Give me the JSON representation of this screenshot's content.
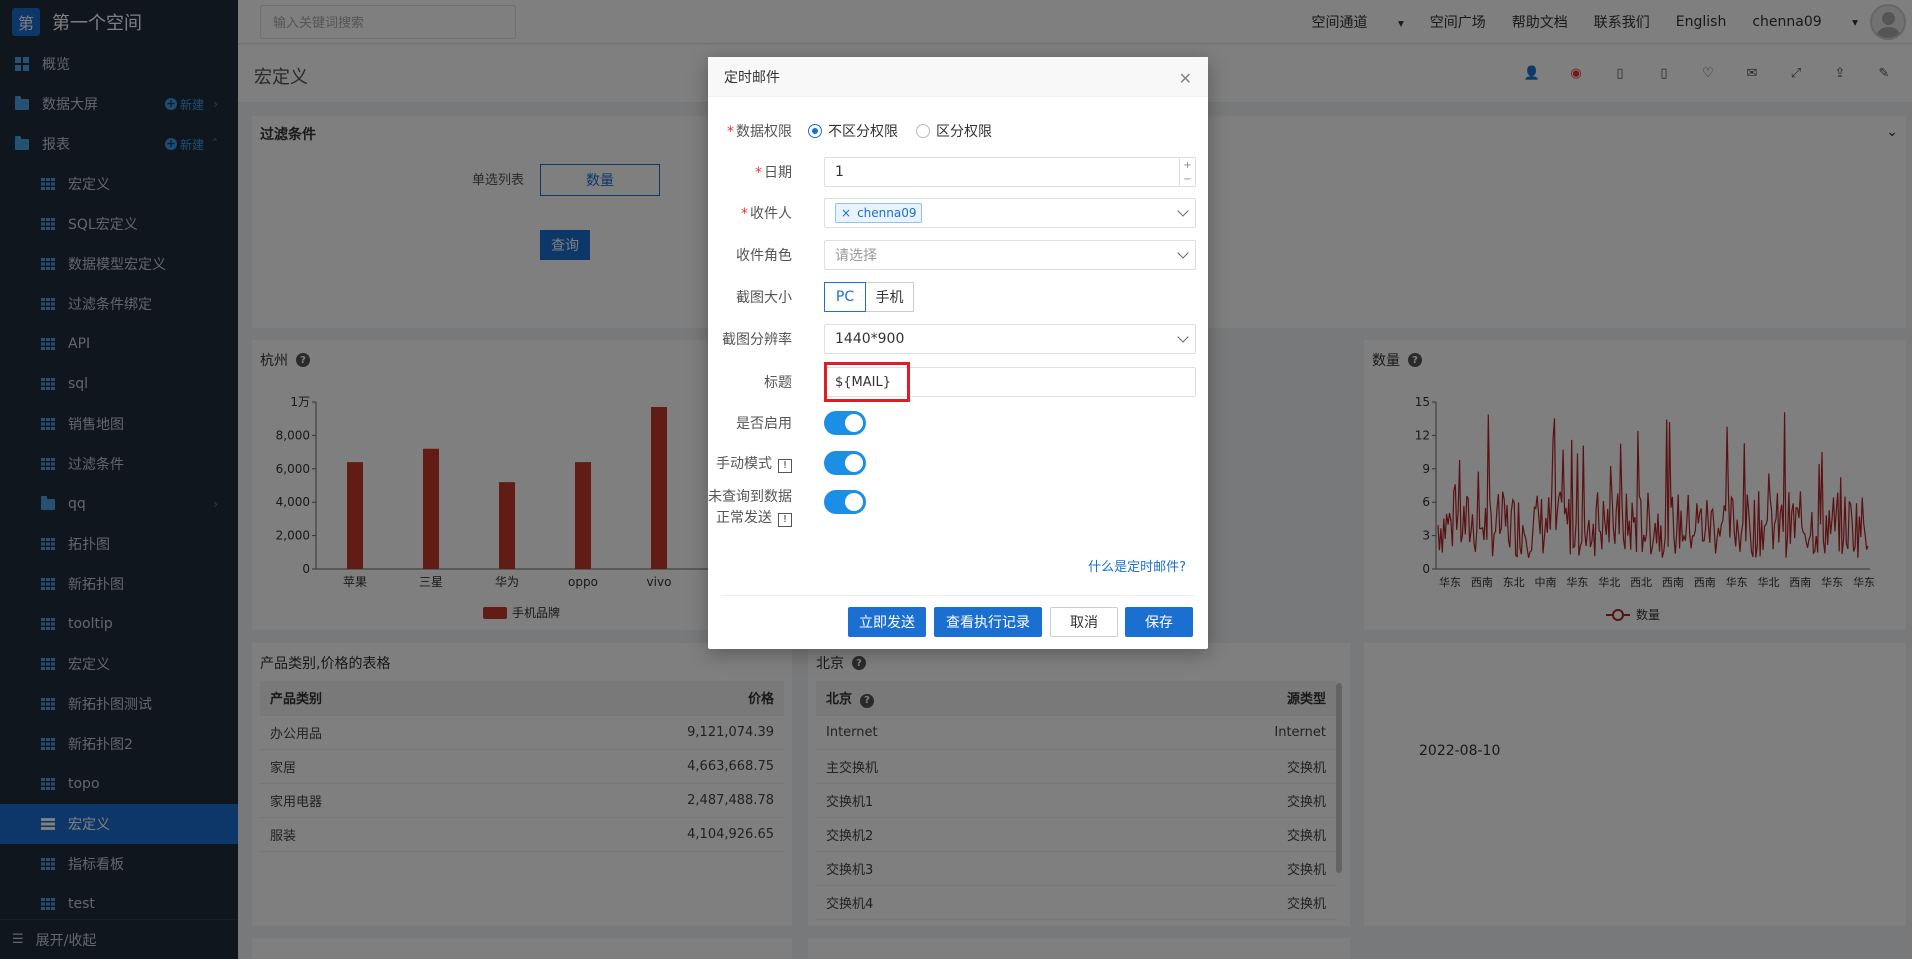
{
  "sidebar": {
    "logo_char": "第",
    "space_title": "第一个空间",
    "items": [
      {
        "label": "概览"
      },
      {
        "label": "数据大屏",
        "new_label": "新建"
      },
      {
        "label": "报表",
        "new_label": "新建"
      },
      {
        "label": "宏定义"
      },
      {
        "label": "SQL宏定义"
      },
      {
        "label": "数据模型宏定义"
      },
      {
        "label": "过滤条件绑定"
      },
      {
        "label": "API"
      },
      {
        "label": "sql"
      },
      {
        "label": "销售地图"
      },
      {
        "label": "过滤条件"
      },
      {
        "label": "qq"
      },
      {
        "label": "拓扑图"
      },
      {
        "label": "新拓扑图"
      },
      {
        "label": "tooltip"
      },
      {
        "label": "宏定义"
      },
      {
        "label": "新拓扑图测试"
      },
      {
        "label": "新拓扑图2"
      },
      {
        "label": "topo"
      },
      {
        "label": "宏定义"
      },
      {
        "label": "指标看板"
      },
      {
        "label": "test"
      }
    ],
    "footer": "展开/收起"
  },
  "topbar": {
    "search_placeholder": "输入关键词搜索",
    "nav": [
      "空间通道",
      "空间广场",
      "帮助文档",
      "联系我们",
      "English",
      "chenna09"
    ]
  },
  "page": {
    "title": "宏定义"
  },
  "filter": {
    "title": "过滤条件",
    "single_list_label": "单选列表",
    "single_list_value": "数量",
    "query_button": "查询"
  },
  "chart_bar": {
    "title": "杭州",
    "y_ticks": [
      "1万",
      "8,000",
      "6,000",
      "4,000",
      "2,000",
      "0"
    ],
    "legend": "手机品牌"
  },
  "chart_line": {
    "title": "数量",
    "y_ticks": [
      "15",
      "12",
      "9",
      "6",
      "3",
      "0"
    ],
    "x_ticks": [
      "华东",
      "西南",
      "东北",
      "中南",
      "华东",
      "华北",
      "西北",
      "西南",
      "西南",
      "华东",
      "华北",
      "西南",
      "华东",
      "华东"
    ],
    "legend": "数量"
  },
  "chart_data": [
    {
      "type": "bar",
      "title": "杭州",
      "categories": [
        "苹果",
        "三星",
        "华为",
        "oppo",
        "vivo"
      ],
      "series": [
        {
          "name": "手机品牌",
          "values": [
            6400,
            7200,
            5200,
            6400,
            9700
          ]
        }
      ],
      "ylim": [
        0,
        10000
      ],
      "color": "#c0392b"
    },
    {
      "type": "line",
      "title": "数量",
      "ylim": [
        0,
        15
      ],
      "series": [
        {
          "name": "数量"
        }
      ],
      "color": "#b22222"
    }
  ],
  "table_products": {
    "title": "产品类别,价格的表格",
    "headers": [
      "产品类别",
      "价格"
    ],
    "rows": [
      [
        "办公用品",
        "9,121,074.39"
      ],
      [
        "家居",
        "4,663,668.75"
      ],
      [
        "家用电器",
        "2,487,488.78"
      ],
      [
        "服装",
        "4,104,926.65"
      ]
    ]
  },
  "table_beijing": {
    "title": "北京",
    "headers": [
      "北京",
      "源类型"
    ],
    "rows": [
      [
        "Internet",
        "Internet"
      ],
      [
        "主交换机",
        "交换机"
      ],
      [
        "交换机1",
        "交换机"
      ],
      [
        "交换机2",
        "交换机"
      ],
      [
        "交换机3",
        "交换机"
      ],
      [
        "交换机4",
        "交换机"
      ]
    ]
  },
  "date_panel": {
    "value": "2022-08-10"
  },
  "modal": {
    "title": "定时邮件",
    "perm_label": "数据权限",
    "perm_options": [
      "不区分权限",
      "区分权限"
    ],
    "date_label": "日期",
    "date_value": "1",
    "recipient_label": "收件人",
    "recipient_tag": "chenna09",
    "role_label": "收件角色",
    "role_placeholder": "请选择",
    "size_label": "截图大小",
    "size_options": [
      "PC",
      "手机"
    ],
    "res_label": "截图分辨率",
    "res_value": "1440*900",
    "subject_label": "标题",
    "subject_value": "${MAIL}",
    "enable_label": "是否启用",
    "manual_label": "手动模式",
    "nodata_label_1": "未查询到数据",
    "nodata_label_2": "正常发送",
    "help_link": "什么是定时邮件?",
    "btn_send": "立即发送",
    "btn_log": "查看执行记录",
    "btn_cancel": "取消",
    "btn_save": "保存"
  }
}
